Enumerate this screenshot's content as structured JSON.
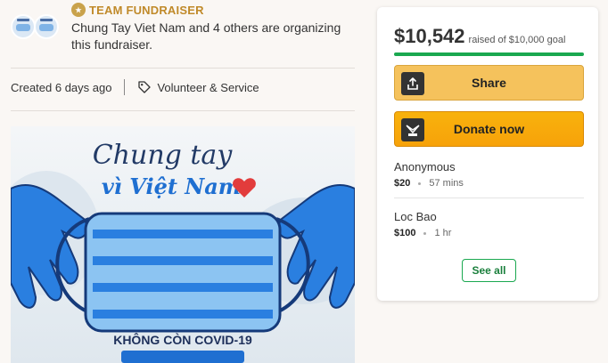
{
  "organizer": {
    "team_label": "TEAM FUNDRAISER",
    "description": "Chung Tay Viet Nam and 4 others are organizing this fundraiser."
  },
  "meta": {
    "created": "Created 6 days ago",
    "category": "Volunteer & Service"
  },
  "hero": {
    "title_line1": "Chung tay",
    "title_line2": "vì Việt Nam",
    "banner": "KHÔNG CÒN COVID-19"
  },
  "donation_card": {
    "raised_amount": "$10,542",
    "goal_text": "raised of $10,000 goal",
    "progress_percent": 100,
    "share_label": "Share",
    "donate_label": "Donate now",
    "donations": [
      {
        "name": "Anonymous",
        "amount": "$20",
        "time": "57 mins"
      },
      {
        "name": "Loc Bao",
        "amount": "$100",
        "time": "1 hr"
      }
    ],
    "see_all_label": "See all"
  },
  "colors": {
    "progress": "#1aa850",
    "share_button": "#f5c25c",
    "donate_button": "#f7a20a",
    "team_label": "#c08a2a"
  },
  "icons": [
    "team-badge-icon",
    "tag-icon",
    "share-icon",
    "donate-icon"
  ]
}
